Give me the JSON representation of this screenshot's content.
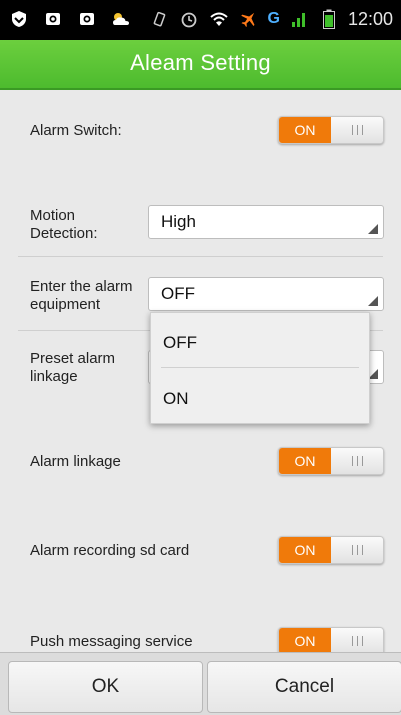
{
  "status_bar": {
    "time": "12:00",
    "network_label": "G",
    "left_icons": [
      "shield-icon",
      "camera-icon",
      "camera-icon",
      "cloud-icon"
    ],
    "right_icons": [
      "vibrate-icon",
      "alarm-clock-icon",
      "wifi-icon",
      "airplane-icon",
      "signal-icon",
      "battery-icon"
    ]
  },
  "header": {
    "title": "Aleam Setting"
  },
  "rows": {
    "alarm_switch": {
      "label": "Alarm Switch:",
      "toggle": "ON"
    },
    "motion_detection": {
      "label": "Motion Detection:",
      "value": "High"
    },
    "enter_alarm_equipment": {
      "label": "Enter the alarm equipment",
      "value": "OFF"
    },
    "preset_alarm_linkage": {
      "label": "Preset alarm linkage"
    },
    "alarm_linkage": {
      "label": "Alarm linkage",
      "toggle": "ON"
    },
    "alarm_recording_sd": {
      "label": "Alarm recording sd card",
      "toggle": "ON"
    },
    "push_messaging": {
      "label": "Push messaging service",
      "toggle": "ON"
    }
  },
  "dropdown": {
    "options": [
      "OFF",
      "ON"
    ]
  },
  "footer": {
    "ok_label": "OK",
    "cancel_label": "Cancel"
  }
}
